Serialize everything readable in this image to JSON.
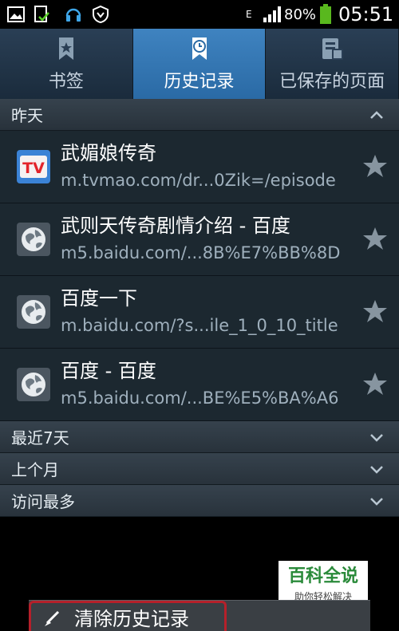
{
  "status_bar": {
    "network": "E",
    "battery": "80%",
    "time": "05:51",
    "battery_color": "#59b81e"
  },
  "tabs": [
    {
      "label": "书签",
      "icon": "bookmark-icon",
      "active": false
    },
    {
      "label": "历史记录",
      "icon": "history-clock-icon",
      "active": true
    },
    {
      "label": "已保存的页面",
      "icon": "saved-pages-icon",
      "active": false
    }
  ],
  "sections": {
    "yesterday": "昨天",
    "last_7_days": "最近7天",
    "last_month": "上个月",
    "most_visited": "访问最多"
  },
  "history": [
    {
      "title": "武媚娘传奇",
      "url": "m.tvmao.com/dr...0Zik=/episode",
      "icon": "tv-icon"
    },
    {
      "title": "武则天传奇剧情介绍 - 百度",
      "url": "m5.baidu.com/...8B%E7%BB%8D",
      "icon": "globe-icon"
    },
    {
      "title": "百度一下",
      "url": "m.baidu.com/?s...ile_1_0_10_title",
      "icon": "globe-icon"
    },
    {
      "title": "百度 - 百度",
      "url": "m5.baidu.com/...BE%E5%BA%A6",
      "icon": "globe-icon"
    }
  ],
  "watermark": {
    "line1": "百科全说",
    "line2": "助你轻松解决"
  },
  "menu": {
    "clear_history": "清除历史记录"
  }
}
